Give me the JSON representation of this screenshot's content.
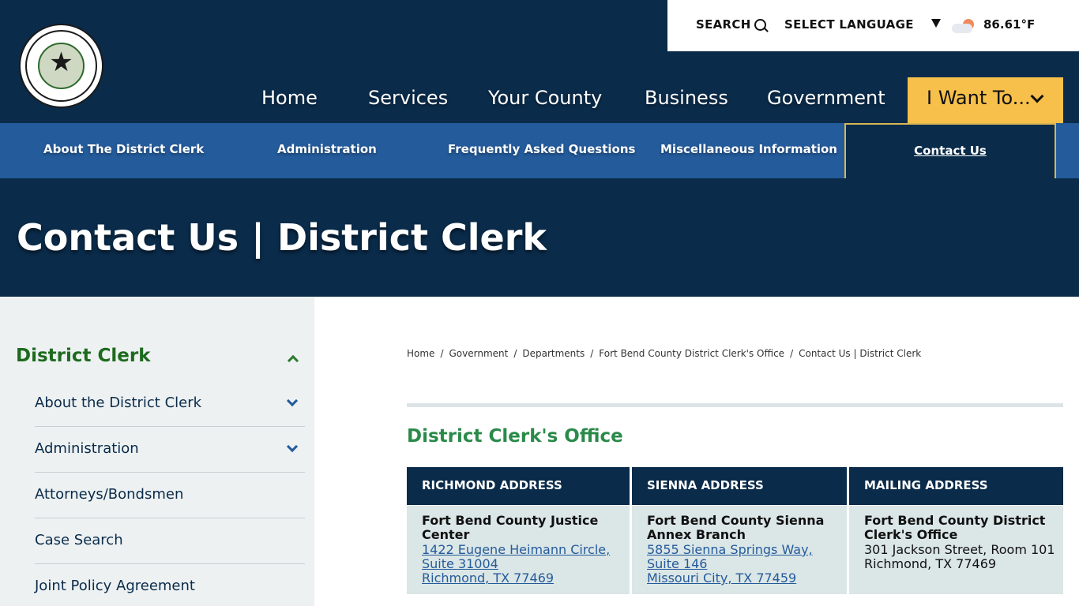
{
  "header": {
    "seal_alt": "The State of Texas Fort Bend County seal",
    "utility": {
      "search_label": "SEARCH",
      "language_label": "SELECT LANGUAGE",
      "temperature": "86.61°F"
    },
    "nav": {
      "items": [
        {
          "label": "Home"
        },
        {
          "label": "Services"
        },
        {
          "label": "Your County"
        },
        {
          "label": "Business"
        },
        {
          "label": "Government"
        }
      ],
      "want_to_label": "I Want To..."
    }
  },
  "subnav": {
    "items": [
      {
        "label": "About The District Clerk"
      },
      {
        "label": "Administration"
      },
      {
        "label": "Frequently Asked Questions"
      },
      {
        "label": "Miscellaneous Information"
      }
    ],
    "active_label": "Contact Us"
  },
  "banner": {
    "title": "Contact Us | District Clerk"
  },
  "sidebar": {
    "title": "District Clerk",
    "items": [
      {
        "label": "About the District Clerk",
        "expandable": true
      },
      {
        "label": "Administration",
        "expandable": true
      },
      {
        "label": "Attorneys/Bondsmen",
        "expandable": false
      },
      {
        "label": "Case Search",
        "expandable": false
      },
      {
        "label": "Joint Policy Agreement",
        "expandable": false
      }
    ]
  },
  "breadcrumb": {
    "items": [
      "Home",
      "Government",
      "Departments",
      "Fort Bend County District Clerk's Office",
      "Contact Us | District Clerk"
    ],
    "separator": "/"
  },
  "content": {
    "office_title": "District Clerk's Office",
    "columns": [
      {
        "header": "RICHMOND ADDRESS",
        "name": "Fort Bend County Justice Center",
        "lines": [
          "1422 Eugene Heimann Circle,",
          "Suite 31004",
          "Richmond, TX 77469"
        ],
        "linked": true
      },
      {
        "header": "SIENNA ADDRESS",
        "name": "Fort Bend County Sienna Annex Branch",
        "lines": [
          "5855 Sienna Springs Way,",
          "Suite 146",
          "Missouri City, TX 77459"
        ],
        "linked": true
      },
      {
        "header": "MAILING ADDRESS",
        "name": "Fort Bend County District Clerk's Office",
        "lines": [
          "301 Jackson Street, Room 101",
          "Richmond, TX 77469"
        ],
        "linked": false
      }
    ]
  },
  "colors": {
    "navy": "#0a2b4a",
    "blue": "#245b9b",
    "gold": "#f7c04a",
    "green": "#2a8a4a"
  }
}
